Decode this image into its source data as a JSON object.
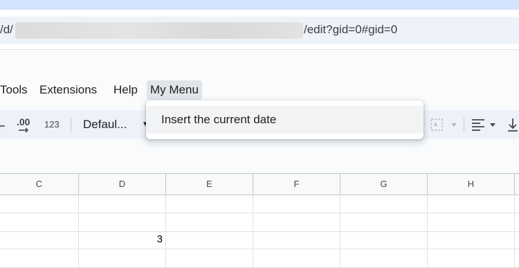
{
  "url_bar": {
    "prefix": "/d/",
    "suffix": "/edit?gid=0#gid=0"
  },
  "menu_bar": {
    "items": [
      "Tools",
      "Extensions",
      "Help",
      "My Menu"
    ]
  },
  "toolbar": {
    "decimal_increase_label": ".00",
    "number_format_label": "123",
    "font_name": "Defaul..."
  },
  "dropdown": {
    "items": [
      "Insert the current date"
    ]
  },
  "grid": {
    "columns": [
      "C",
      "D",
      "E",
      "F",
      "G",
      "H"
    ],
    "cells": {
      "D3": "3"
    }
  },
  "colors": {
    "top_strip": "#d3e3fd",
    "app_background": "#f9fbfd",
    "toolbar_background": "#edf2fa",
    "active_menu": "#e1e5ea"
  }
}
